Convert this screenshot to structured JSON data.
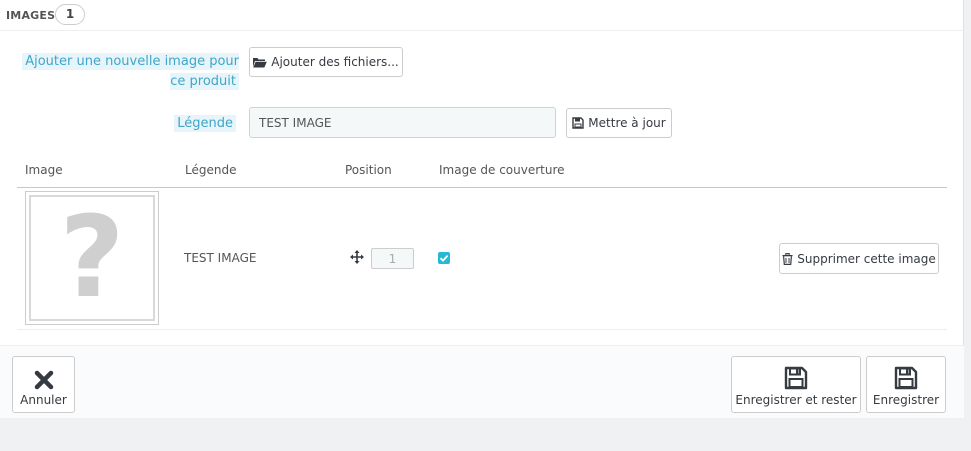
{
  "panel": {
    "title": "Images",
    "count": "1"
  },
  "form": {
    "add_label": "Ajouter une nouvelle image pour ce produit",
    "add_button": "Ajouter des fichiers...",
    "legend_label": "Légende",
    "legend_value": "TEST IMAGE",
    "update_button": "Mettre à jour"
  },
  "table": {
    "headers": [
      "Image",
      "Légende",
      "Position",
      "Image de couverture"
    ],
    "rows": [
      {
        "legend": "TEST IMAGE",
        "position": "1",
        "cover": true,
        "delete_button": "Supprimer cette image"
      }
    ]
  },
  "footer": {
    "cancel": "Annuler",
    "save_stay": "Enregistrer et rester",
    "save": "Enregistrer"
  },
  "icons": {
    "add": "folder-open-icon",
    "update": "floppy-disk-icon",
    "move": "move-arrows-icon",
    "delete": "trash-icon",
    "cancel": "close-icon",
    "save": "floppy-disk-icon"
  },
  "colors": {
    "accent": "#25b9d7",
    "label": "#3ea6c8",
    "label_bg": "#e7f5fa",
    "table_head_line": "#a6d6d1"
  }
}
